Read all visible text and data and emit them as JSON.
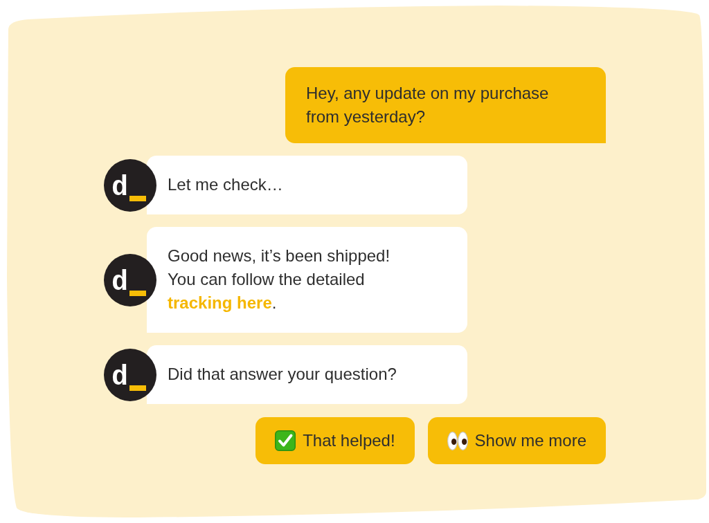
{
  "messages": [
    {
      "kind": "user",
      "text": "Hey, any update on my purchase from yesterday?"
    },
    {
      "kind": "bot",
      "avatar": "d",
      "text": "Let me check…"
    },
    {
      "kind": "bot",
      "avatar": "d",
      "text": "Good news, it’s been shipped! You can follow the detailed",
      "link": "tracking here",
      "text_after": "."
    },
    {
      "kind": "bot",
      "avatar": "d",
      "text": "Did that answer your question?"
    }
  ],
  "quick_replies": [
    {
      "kind": "confirm",
      "label": "That helped!"
    },
    {
      "kind": "more",
      "label": "Show me more"
    }
  ]
}
